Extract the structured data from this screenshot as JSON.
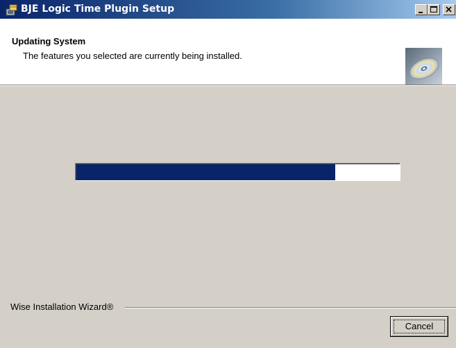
{
  "window": {
    "title": "BJE Logic Time Plugin Setup",
    "icons": {
      "app": "setup-icon",
      "minimize": "minimize-icon",
      "maximize": "maximize-icon",
      "close": "close-icon"
    }
  },
  "header": {
    "title": "Updating System",
    "subtitle": "The features you selected are currently being installed.",
    "icon": "cd-icon"
  },
  "progress": {
    "value": 0.8,
    "color": "#0a246a"
  },
  "footer": {
    "brand": "Wise Installation Wizard®",
    "cancel_label": "Cancel"
  },
  "colors": {
    "titlebar_start": "#0a246a",
    "titlebar_end": "#a6caf0",
    "dialog_background": "#d4d0c8"
  }
}
